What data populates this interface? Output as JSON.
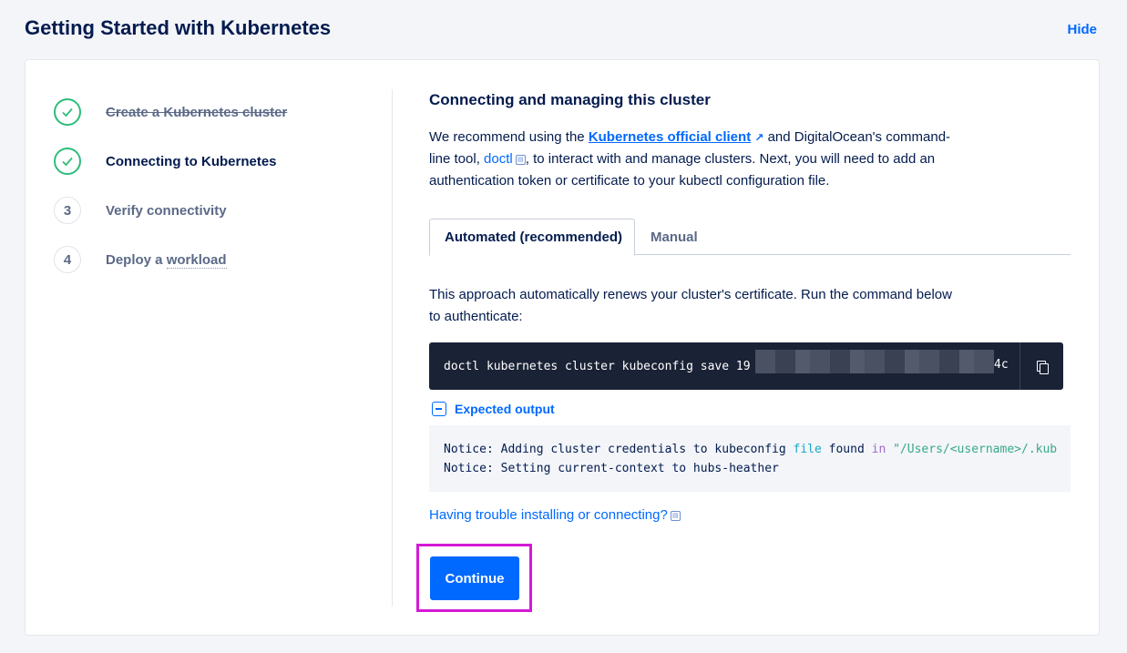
{
  "header": {
    "title": "Getting Started with Kubernetes",
    "hide_label": "Hide"
  },
  "steps": [
    {
      "marker": "✓",
      "label": "Create a Kubernetes cluster",
      "state": "completed"
    },
    {
      "marker": "✓",
      "label": "Connecting to Kubernetes",
      "state": "active"
    },
    {
      "marker": "3",
      "label": "Verify connectivity",
      "state": "pending"
    },
    {
      "marker": "4",
      "label_a": "Deploy a ",
      "label_b": "workload",
      "state": "pending"
    }
  ],
  "main": {
    "title": "Connecting and managing this cluster",
    "intro": {
      "part1": "We recommend using the ",
      "link1": "Kubernetes official client",
      "part2": " and DigitalOcean's command-line tool, ",
      "link2": "doctl",
      "part3": ", to interact with and manage clusters. Next, you will need to add an authentication token or certificate to your kubectl configuration file."
    },
    "tabs": [
      {
        "label": "Automated (recommended)",
        "active": true
      },
      {
        "label": "Manual",
        "active": false
      }
    ],
    "approach_text": "This approach automatically renews your cluster's certificate. Run the command below to authenticate:",
    "command": {
      "visible_prefix": "doctl kubernetes cluster kubeconfig save 19",
      "visible_suffix": "4c"
    },
    "expected_output": {
      "label": "Expected output",
      "line1": {
        "a": "Notice: Adding cluster credentials to kubeconfig ",
        "file": "file",
        "b": " found ",
        "in": "in",
        "c": " ",
        "path": "\"/Users/<username>/.kub"
      },
      "line2": "Notice: Setting current-context to hubs-heather"
    },
    "trouble_link": "Having trouble installing or connecting?",
    "continue_label": "Continue"
  },
  "colors": {
    "accent": "#0069ff",
    "check_green": "#2ebd79",
    "code_bg": "#1a2235",
    "highlight": "#d41ad4"
  }
}
